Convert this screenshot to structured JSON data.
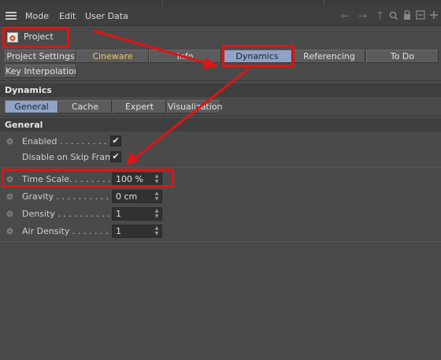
{
  "menubar": {
    "items": [
      "Mode",
      "Edit",
      "User Data"
    ],
    "icons": [
      "hamburger-icon",
      "back-arrow-icon",
      "forward-arrow-icon",
      "up-arrow-icon",
      "search-icon",
      "lock-icon",
      "more-icon",
      "add-icon"
    ]
  },
  "project": {
    "title": "Project",
    "icon": "project-gear-icon"
  },
  "tabs": [
    {
      "label": "Project Settings",
      "selected": false
    },
    {
      "label": "Cineware",
      "selected": false
    },
    {
      "label": "Info",
      "selected": false
    },
    {
      "label": "Dynamics",
      "selected": true
    },
    {
      "label": "Referencing",
      "selected": false
    },
    {
      "label": "To Do",
      "selected": false
    },
    {
      "label": "Key Interpolation",
      "selected": false
    }
  ],
  "section": {
    "title": "Dynamics",
    "subtabs": [
      {
        "label": "General",
        "selected": true
      },
      {
        "label": "Cache",
        "selected": false
      },
      {
        "label": "Expert",
        "selected": false
      },
      {
        "label": "Visualization",
        "selected": false
      }
    ],
    "group_title": "General"
  },
  "params": {
    "enabled": {
      "label": "Enabled . . . . . . . . .",
      "checked": true,
      "mark": "✔"
    },
    "disable_skip": {
      "label": "Disable on Skip Frame",
      "checked": true,
      "mark": "✔"
    },
    "time_scale": {
      "label": "Time Scale. . . . . . . .",
      "value": "100 %"
    },
    "gravity": {
      "label": "Gravity . . . . . . . . . .",
      "value": "0 cm"
    },
    "density": {
      "label": "Density . . . . . . . . . .",
      "value": "1"
    },
    "air_density": {
      "label": "Air Density . . . . . . .",
      "value": "1"
    }
  },
  "colors": {
    "background": "#4a4a4a",
    "tab_selected": "#8ea3c7",
    "cineware_text": "#e8c869",
    "annotation_red": "#e01414"
  }
}
